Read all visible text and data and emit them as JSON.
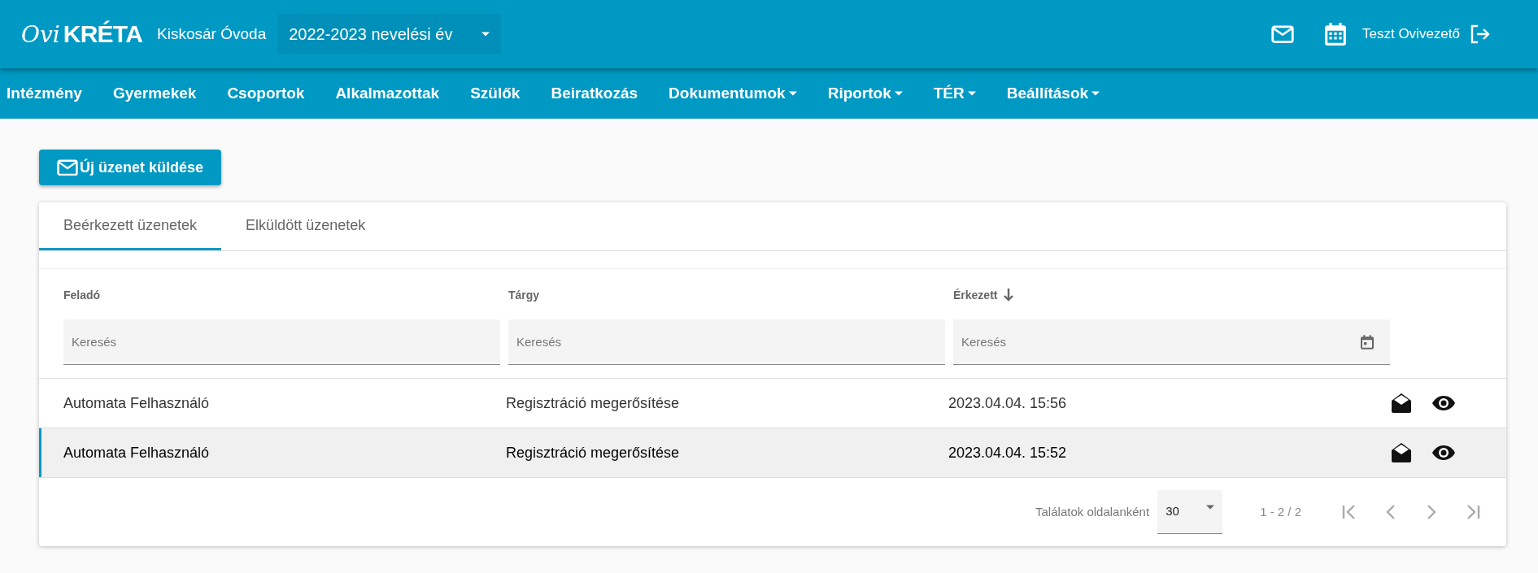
{
  "header": {
    "logo": {
      "script": "Ovi",
      "word": "KRÉTA"
    },
    "institution": "Kiskosár Óvoda",
    "year_select": {
      "value": "2022-2023 nevelési év"
    },
    "user": "Teszt Ovivezető"
  },
  "nav": [
    {
      "label": "Intézmény",
      "has_menu": false
    },
    {
      "label": "Gyermekek",
      "has_menu": false
    },
    {
      "label": "Csoportok",
      "has_menu": false
    },
    {
      "label": "Alkalmazottak",
      "has_menu": false
    },
    {
      "label": "Szülők",
      "has_menu": false
    },
    {
      "label": "Beiratkozás",
      "has_menu": false
    },
    {
      "label": "Dokumentumok",
      "has_menu": true
    },
    {
      "label": "Riportok",
      "has_menu": true
    },
    {
      "label": "TÉR",
      "has_menu": true
    },
    {
      "label": "Beállítások",
      "has_menu": true
    }
  ],
  "new_message_button": "Új üzenet küldése",
  "tabs": [
    {
      "label": "Beérkezett üzenetek",
      "selected": true
    },
    {
      "label": "Elküldött üzenetek",
      "selected": false
    }
  ],
  "table": {
    "columns": [
      {
        "label": "Feladó",
        "sorted": false,
        "placeholder": "Keresés",
        "kind": "text"
      },
      {
        "label": "Tárgy",
        "sorted": false,
        "placeholder": "Keresés",
        "kind": "text"
      },
      {
        "label": "Érkezett",
        "sorted": true,
        "placeholder": "Keresés",
        "kind": "date"
      }
    ],
    "rows": [
      {
        "cells": [
          "Automata Felhasználó",
          "Regisztráció megerősítése",
          "2023.04.04. 15:56"
        ],
        "selected": false
      },
      {
        "cells": [
          "Automata Felhasználó",
          "Regisztráció megerősítése",
          "2023.04.04. 15:52"
        ],
        "selected": true
      }
    ]
  },
  "pagination": {
    "per_page_label": "Találatok oldalanként",
    "per_page": "30",
    "range": "1 - 2 / 2"
  }
}
